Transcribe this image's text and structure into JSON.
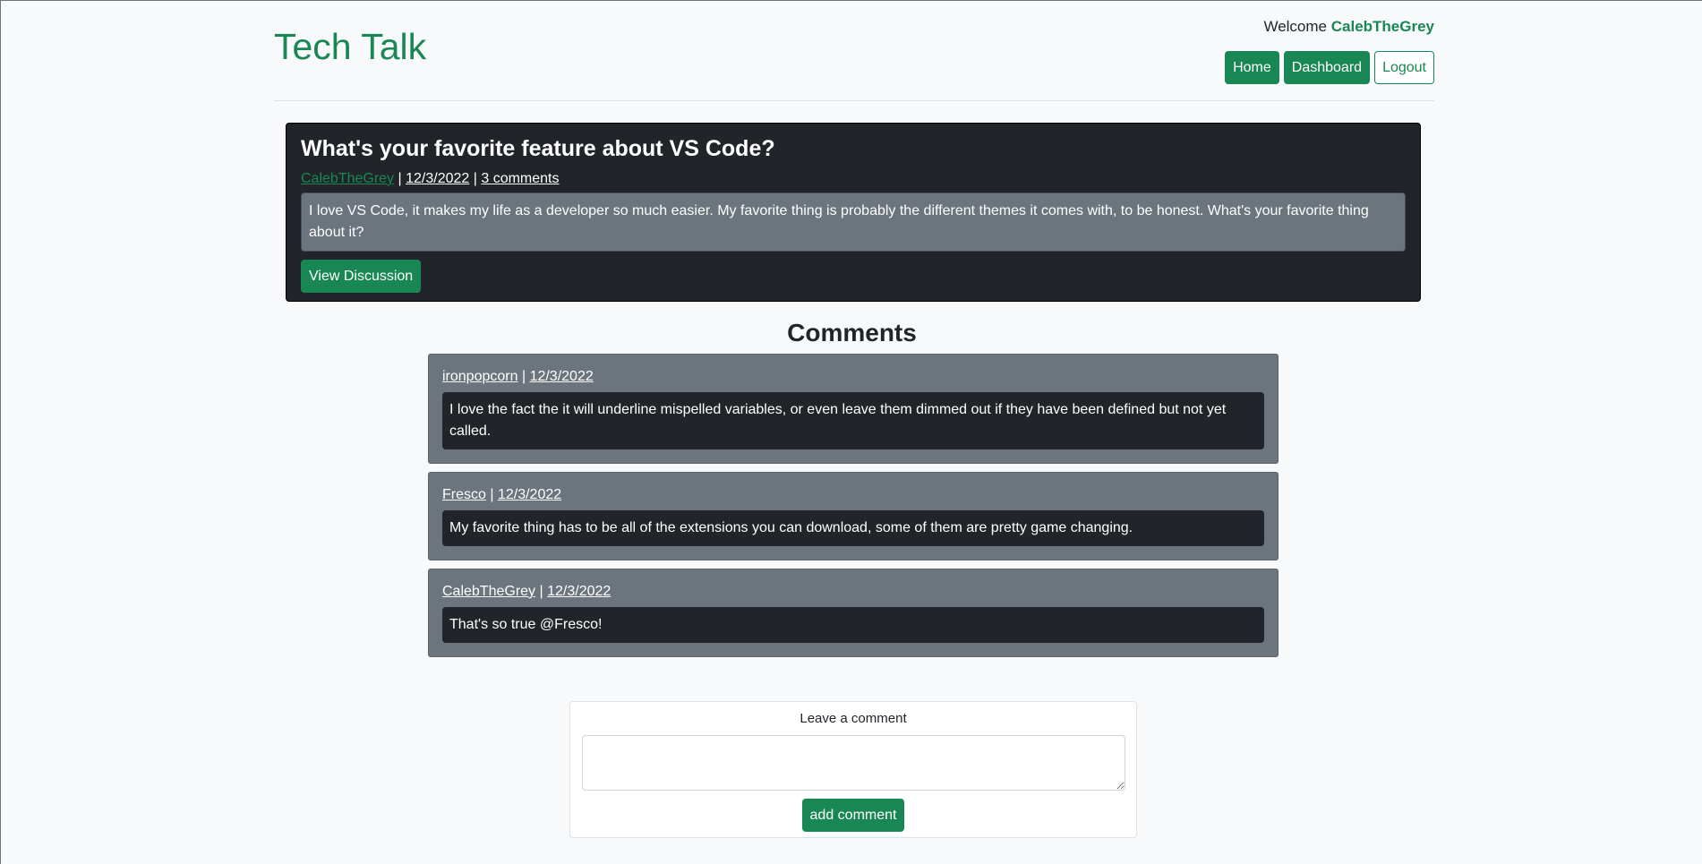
{
  "header": {
    "brand": "Tech Talk",
    "welcome_prefix": "Welcome",
    "username": "CalebTheGrey",
    "nav": {
      "home": "Home",
      "dashboard": "Dashboard",
      "logout": "Logout"
    }
  },
  "post": {
    "title": "What's your favorite feature about VS Code?",
    "author": "CalebTheGrey",
    "date": "12/3/2022",
    "comments_link": "3 comments",
    "body": "I love VS Code, it makes my life as a developer so much easier. My favorite thing is probably the different themes it comes with, to be honest. What's your favorite thing about it?",
    "view_button": "View Discussion"
  },
  "comments_title": "Comments",
  "comments": [
    {
      "author": "ironpopcorn",
      "date": "12/3/2022",
      "body": "I love the fact the it will underline mispelled variables, or even leave them dimmed out if they have been defined but not yet called."
    },
    {
      "author": "Fresco",
      "date": "12/3/2022",
      "body": "My favorite thing has to be all of the extensions you can download, some of them are pretty game changing."
    },
    {
      "author": "CalebTheGrey",
      "date": "12/3/2022",
      "body": "That's so true @Fresco!"
    }
  ],
  "comment_form": {
    "label": "Leave a comment",
    "value": "",
    "submit": "add comment"
  },
  "colors": {
    "accent": "#198754",
    "dark": "#212529",
    "secondary": "#6c757d",
    "background": "#f8f9fa"
  },
  "separator": "|"
}
